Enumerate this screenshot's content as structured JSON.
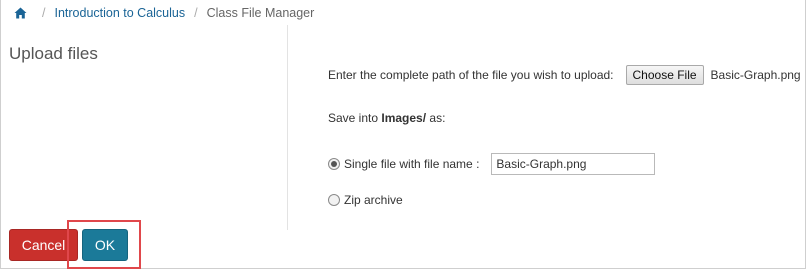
{
  "breadcrumb": {
    "home_icon": "home-icon",
    "course_link": "Introduction to Calculus",
    "current": "Class File Manager"
  },
  "page": {
    "title": "Upload files"
  },
  "upload": {
    "prompt": "Enter the complete path of the file you wish to upload:",
    "choose_button": "Choose File",
    "selected_file": "Basic-Graph.png"
  },
  "save": {
    "prefix": "Save into ",
    "folder": "Images/",
    "suffix": " as:"
  },
  "options": {
    "single_label": "Single file with file name :",
    "single_selected": true,
    "filename_value": "Basic-Graph.png",
    "zip_label": "Zip archive"
  },
  "actions": {
    "cancel_label": "Cancel",
    "ok_label": "OK"
  },
  "colors": {
    "link": "#1a6496",
    "cancel": "#c9302c",
    "ok": "#1b7a99",
    "highlight": "#e0474b"
  }
}
